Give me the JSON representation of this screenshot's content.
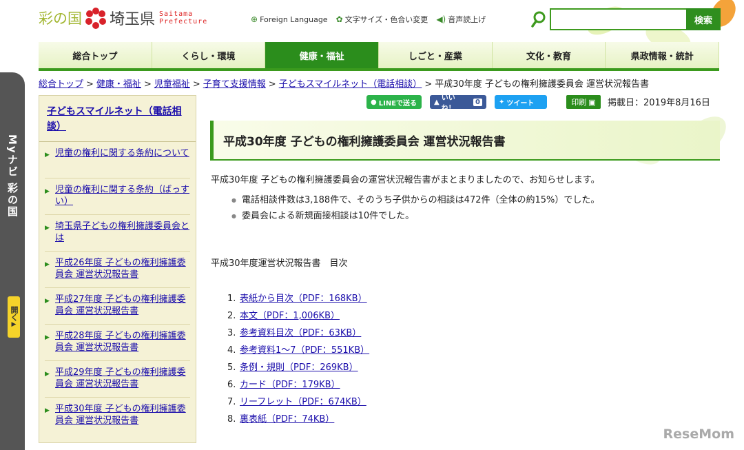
{
  "header": {
    "logo_sainokuni": "彩の国",
    "logo_ken": "埼玉県",
    "logo_en_line1": "Saitama",
    "logo_en_line2": "Prefecture",
    "util": {
      "foreign": "Foreign Language",
      "font_color": "文字サイズ・色合い変更",
      "speech": "音声読上げ"
    },
    "search": {
      "value": "",
      "button": "検索"
    }
  },
  "nav": [
    "総合トップ",
    "くらし・環境",
    "健康・福祉",
    "しごと・産業",
    "文化・教育",
    "県政情報・統計"
  ],
  "nav_active_index": 2,
  "breadcrumb": [
    "総合トップ",
    "健康・福祉",
    "児童福祉",
    "子育て支援情報",
    "子どもスマイルネット（電話相談）"
  ],
  "breadcrumb_current": "平成30年度 子どもの権利擁護委員会 運営状況報告書",
  "breadcrumb_sep": ">",
  "side_tab": {
    "label": "Myナビ 彩の国",
    "open": "開く"
  },
  "sidebar": {
    "head": "子どもスマイルネット（電話相談）",
    "items": [
      "児童の権利に関する条約について",
      "児童の権利に関する条約（ばっすい）",
      "埼玉県子どもの権利擁護委員会とは",
      "平成26年度 子どもの権利擁護委員会 運営状況報告書",
      "平成27年度 子どもの権利擁護委員会 運営状況報告書",
      "平成28年度 子どもの権利擁護委員会 運営状況報告書",
      "平成29年度 子どもの権利擁護委員会 運営状況報告書",
      "平成30年度 子どもの権利擁護委員会 運営状況報告書"
    ]
  },
  "social": {
    "line": "LINEで送る",
    "like": "いいね！",
    "like_count": "0",
    "tweet": "ツイート",
    "print": "印刷",
    "posted": "掲載日：2019年8月16日"
  },
  "title": "平成30年度 子どもの権利擁護委員会 運営状況報告書",
  "content": {
    "intro": "平成30年度 子どもの権利擁護委員会の運営状況報告書がまとまりましたので、お知らせします。",
    "bullets": [
      "電話相談件数は3,188件で、そのうち子供からの相談は472件（全体の約15%）でした。",
      "委員会による新規面接相談は10件でした。"
    ],
    "toc_title": "平成30年度運営状況報告書　目次",
    "toc": [
      "表紙から目次（PDF：168KB）",
      "本文（PDF：1,006KB）",
      "参考資料目次（PDF：63KB）",
      "参考資料1〜7（PDF：551KB）",
      "条例・規則（PDF：269KB）",
      "カード（PDF：179KB）",
      "リーフレット（PDF：674KB）",
      "裏表紙（PDF：74KB）"
    ]
  },
  "watermark": "ReseMom",
  "colors": {
    "green": "#2b8d1c",
    "leaf": "#a3b733",
    "red": "#d22",
    "link": "#1a0dab"
  }
}
